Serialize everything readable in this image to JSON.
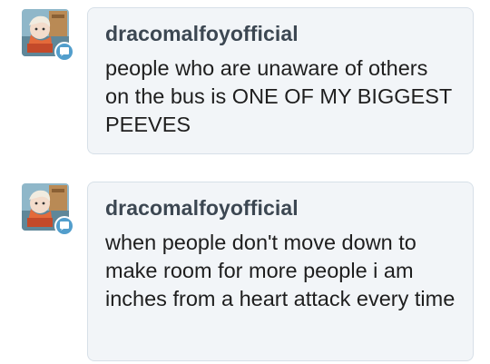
{
  "posts": [
    {
      "username": "dracomalfoyofficial",
      "message": "people who are unaware of others on the bus is ONE OF MY BIGGEST PEEVES",
      "avatar_icon": "user-avatar-icon",
      "badge_icon": "chat-bubble-icon"
    },
    {
      "username": "dracomalfoyofficial",
      "message": "when people don't move down to make room for more people i am inches from a heart attack every time",
      "avatar_icon": "user-avatar-icon",
      "badge_icon": "chat-bubble-icon"
    }
  ],
  "colors": {
    "bubble_bg": "#f2f5f8",
    "bubble_border": "#d7e0e8",
    "username": "#3c4752",
    "badge": "#529ecc"
  }
}
